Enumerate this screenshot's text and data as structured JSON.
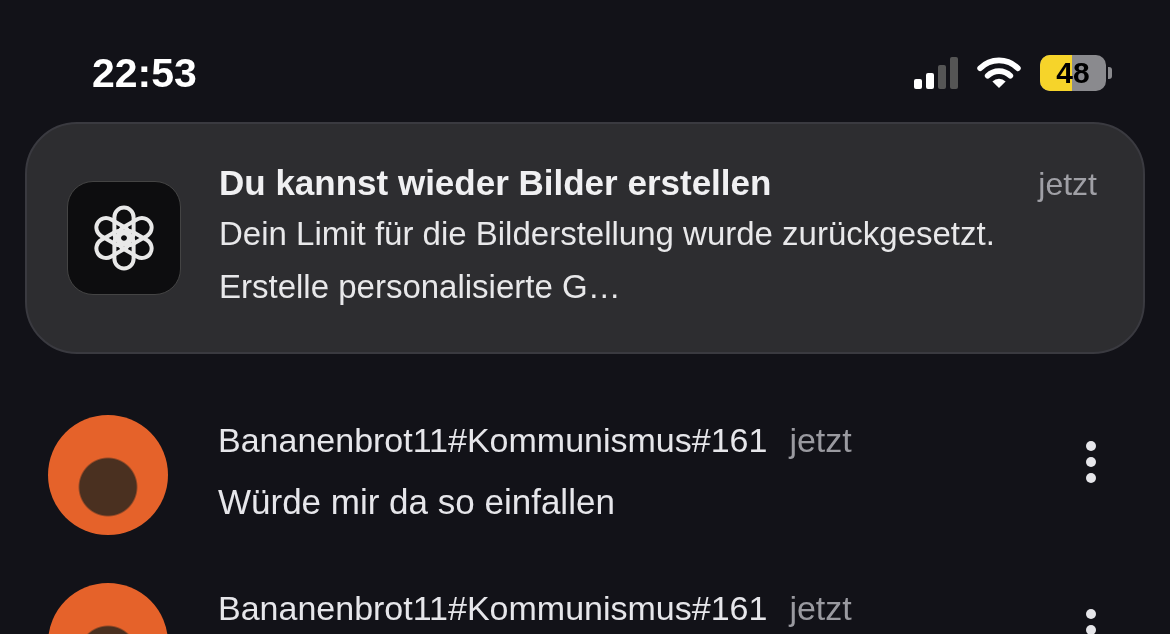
{
  "status_bar": {
    "time": "22:53",
    "battery": {
      "text": "48",
      "level": 0.48
    }
  },
  "notification": {
    "title": "Du kannst wieder Bilder erstellen",
    "time": "jetzt",
    "body": "Dein Limit für die Bilderstellung wurde zurückgesetzt. Erstelle personalisierte G…"
  },
  "comments": [
    {
      "author": "Bananenbrot11#Kommunismus#161",
      "time": "jetzt",
      "text": "Würde mir da so einfallen"
    },
    {
      "author": "Bananenbrot11#Kommunismus#161",
      "time": "jetzt"
    }
  ]
}
